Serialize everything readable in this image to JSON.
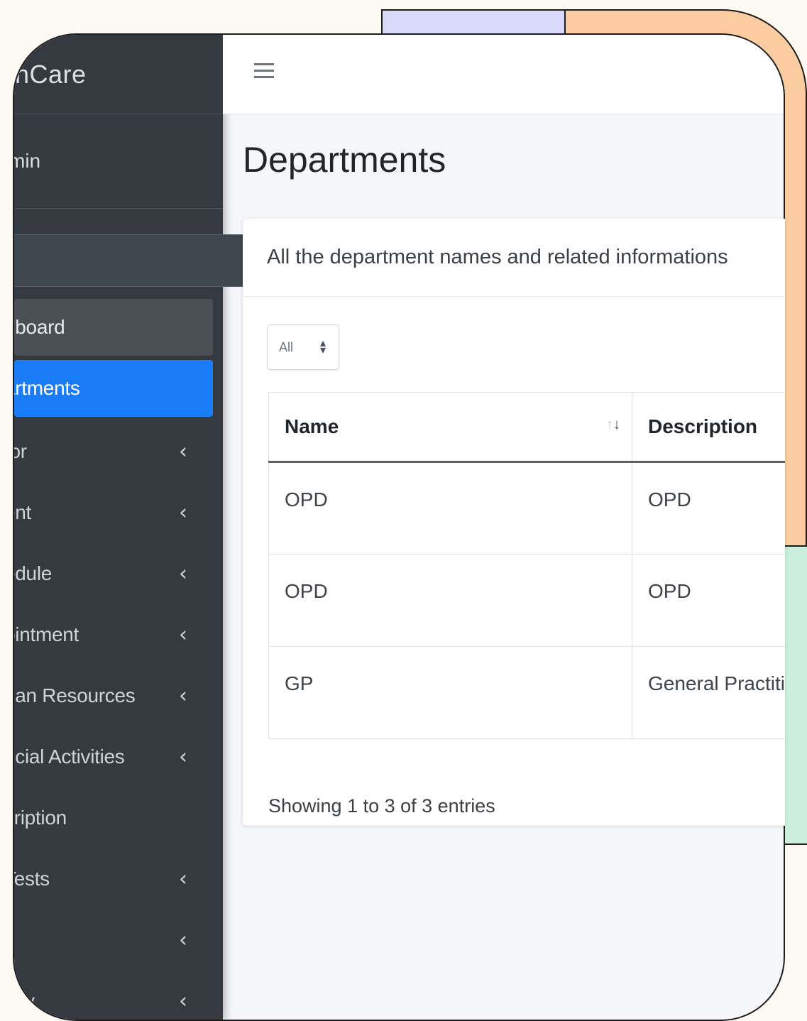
{
  "sidebar": {
    "brand": "lthCare",
    "user": "min",
    "search": {
      "placeholder": "",
      "value": ""
    },
    "items": [
      {
        "label": "hboard",
        "chevron": false,
        "state": "hover"
      },
      {
        "label": "artments",
        "chevron": false,
        "state": "active"
      },
      {
        "label": "tor",
        "chevron": true
      },
      {
        "label": "ent",
        "chevron": true
      },
      {
        "label": "edule",
        "chevron": true
      },
      {
        "label": "ointment",
        "chevron": true
      },
      {
        "label": "nan Resources",
        "chevron": true
      },
      {
        "label": "ncial Activities",
        "chevron": true
      },
      {
        "label": "cription",
        "chevron": false
      },
      {
        "label": "Tests",
        "chevron": true
      },
      {
        "label": "",
        "chevron": true
      },
      {
        "label": "acy",
        "chevron": true
      }
    ]
  },
  "page": {
    "title": "Departments",
    "card_header": "All the department names and related informations",
    "length_select": "All",
    "table": {
      "headers": [
        "Name",
        "Description"
      ],
      "rows": [
        [
          "OPD",
          "OPD"
        ],
        [
          "OPD",
          "OPD"
        ],
        [
          "GP",
          "General Practiti"
        ]
      ]
    },
    "info": "Showing 1 to 3 of 3 entries"
  },
  "colors": {
    "sidebar_bg": "#343a40",
    "active_item": "#1a7cf7",
    "content_bg": "#f4f6f9"
  }
}
